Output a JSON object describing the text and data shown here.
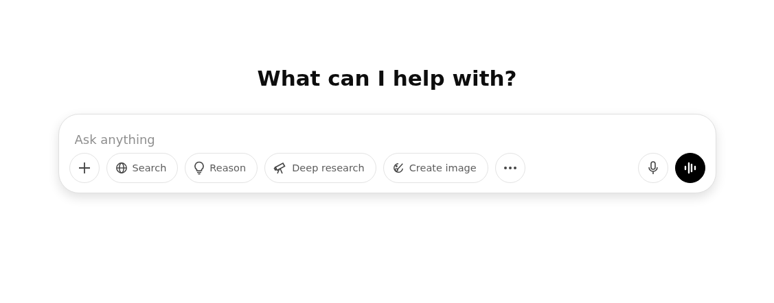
{
  "heading": "What can I help with?",
  "composer": {
    "placeholder": "Ask anything",
    "tools": [
      {
        "kind": "globe",
        "label": "Search"
      },
      {
        "kind": "bulb",
        "label": "Reason"
      },
      {
        "kind": "telescope",
        "label": "Deep research"
      },
      {
        "kind": "brush",
        "label": "Create image"
      }
    ]
  }
}
